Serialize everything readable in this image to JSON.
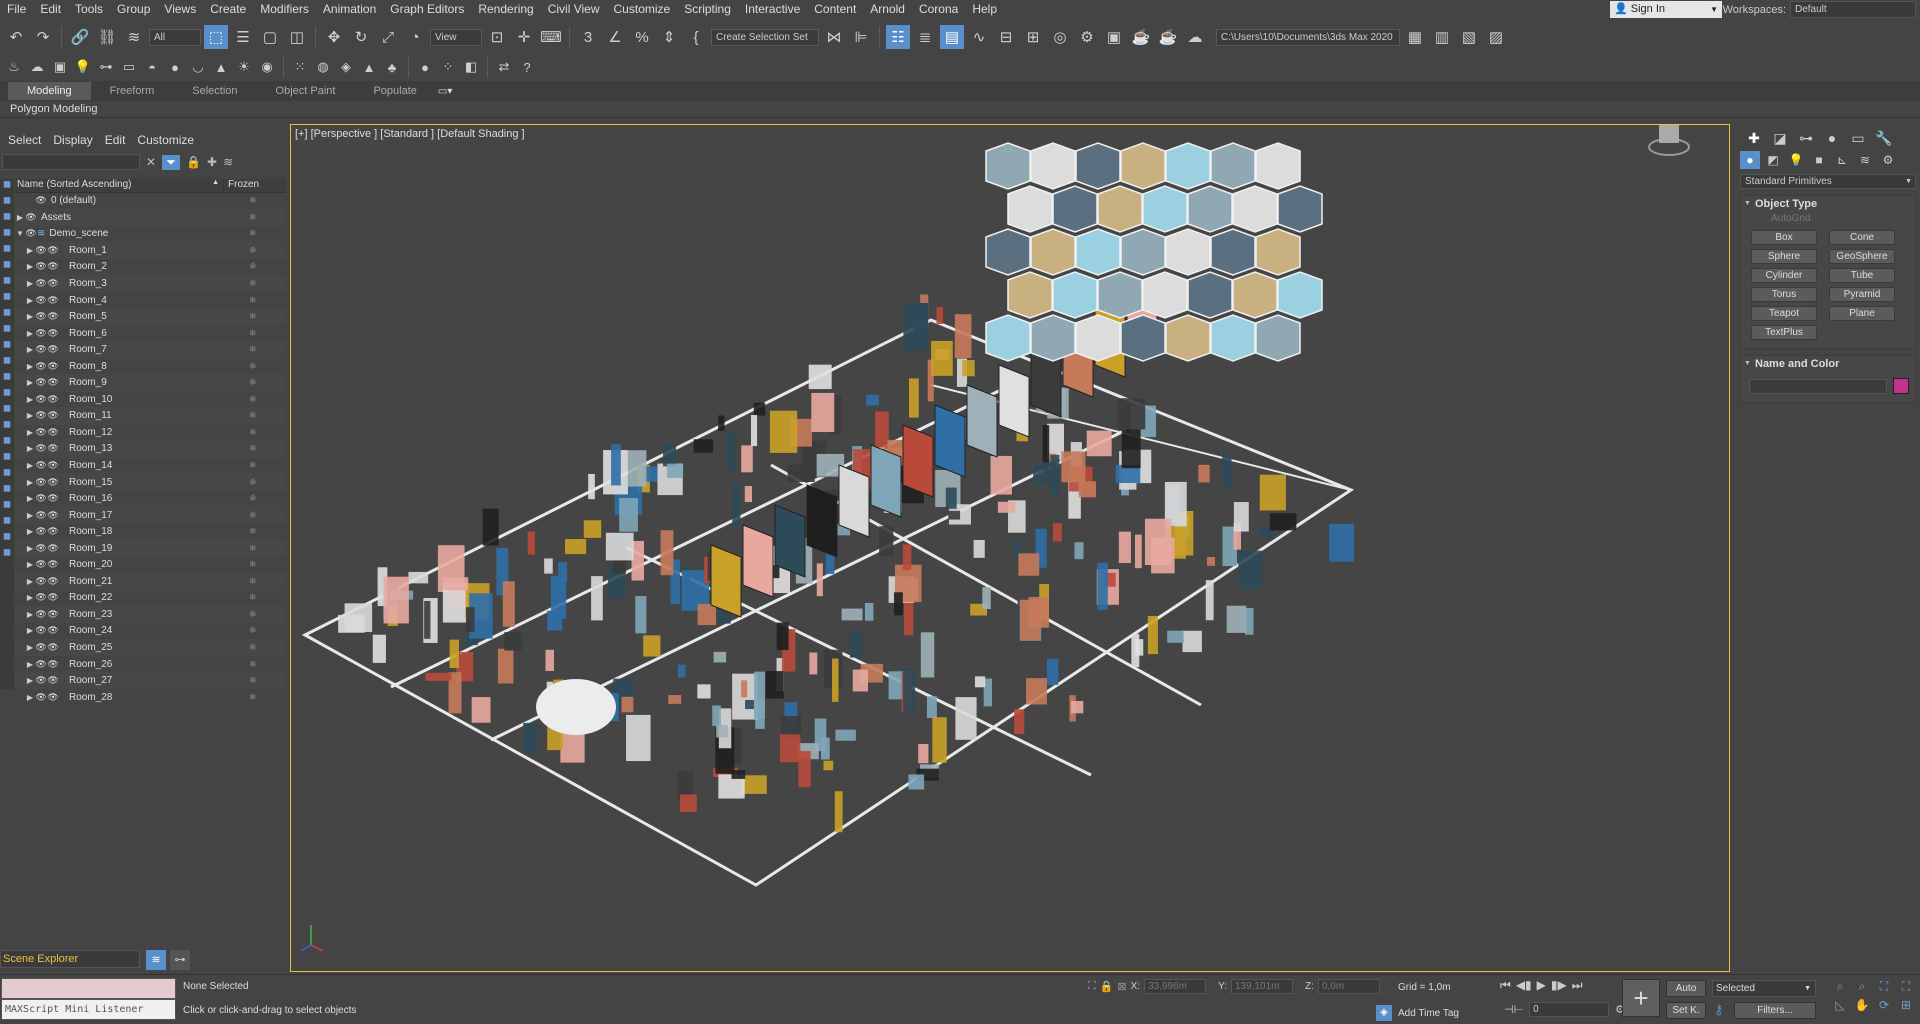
{
  "menu": [
    "File",
    "Edit",
    "Tools",
    "Group",
    "Views",
    "Create",
    "Modifiers",
    "Animation",
    "Graph Editors",
    "Rendering",
    "Civil View",
    "Customize",
    "Scripting",
    "Interactive",
    "Content",
    "Arnold",
    "Corona",
    "Help"
  ],
  "sign_in": "Sign In",
  "workspaces": {
    "label": "Workspaces:",
    "value": "Default"
  },
  "toolbar": {
    "selection_filter": "All",
    "ref_coord": "View",
    "named_selection": "Create Selection Set",
    "project_path": "C:\\Users\\10\\Documents\\3ds Max 2020"
  },
  "ribbon": {
    "tabs": [
      "Modeling",
      "Freeform",
      "Selection",
      "Object Paint",
      "Populate"
    ],
    "sub": "Polygon Modeling"
  },
  "explorer": {
    "menu": [
      "Select",
      "Display",
      "Edit",
      "Customize"
    ],
    "col_name": "Name (Sorted Ascending)",
    "col_frozen": "Frozen",
    "rows": [
      {
        "name": "0 (default)",
        "level": 1,
        "exp": ""
      },
      {
        "name": "Assets",
        "level": 0,
        "exp": "▶"
      },
      {
        "name": "Demo_scene",
        "level": 0,
        "exp": "▼"
      },
      {
        "name": "Room_1",
        "level": 2,
        "exp": "▶"
      },
      {
        "name": "Room_2",
        "level": 2,
        "exp": "▶"
      },
      {
        "name": "Room_3",
        "level": 2,
        "exp": "▶"
      },
      {
        "name": "Room_4",
        "level": 2,
        "exp": "▶"
      },
      {
        "name": "Room_5",
        "level": 2,
        "exp": "▶"
      },
      {
        "name": "Room_6",
        "level": 2,
        "exp": "▶"
      },
      {
        "name": "Room_7",
        "level": 2,
        "exp": "▶"
      },
      {
        "name": "Room_8",
        "level": 2,
        "exp": "▶"
      },
      {
        "name": "Room_9",
        "level": 2,
        "exp": "▶"
      },
      {
        "name": "Room_10",
        "level": 2,
        "exp": "▶"
      },
      {
        "name": "Room_11",
        "level": 2,
        "exp": "▶"
      },
      {
        "name": "Room_12",
        "level": 2,
        "exp": "▶"
      },
      {
        "name": "Room_13",
        "level": 2,
        "exp": "▶"
      },
      {
        "name": "Room_14",
        "level": 2,
        "exp": "▶"
      },
      {
        "name": "Room_15",
        "level": 2,
        "exp": "▶"
      },
      {
        "name": "Room_16",
        "level": 2,
        "exp": "▶"
      },
      {
        "name": "Room_17",
        "level": 2,
        "exp": "▶"
      },
      {
        "name": "Room_18",
        "level": 2,
        "exp": "▶"
      },
      {
        "name": "Room_19",
        "level": 2,
        "exp": "▶"
      },
      {
        "name": "Room_20",
        "level": 2,
        "exp": "▶"
      },
      {
        "name": "Room_21",
        "level": 2,
        "exp": "▶"
      },
      {
        "name": "Room_22",
        "level": 2,
        "exp": "▶"
      },
      {
        "name": "Room_23",
        "level": 2,
        "exp": "▶"
      },
      {
        "name": "Room_24",
        "level": 2,
        "exp": "▶"
      },
      {
        "name": "Room_25",
        "level": 2,
        "exp": "▶"
      },
      {
        "name": "Room_26",
        "level": 2,
        "exp": "▶"
      },
      {
        "name": "Room_27",
        "level": 2,
        "exp": "▶"
      },
      {
        "name": "Room_28",
        "level": 2,
        "exp": "▶"
      }
    ]
  },
  "viewport": {
    "label": "[+] [Perspective ] [Standard ] [Default Shading ]"
  },
  "command_panel": {
    "category": "Standard Primitives",
    "object_type_title": "Object Type",
    "autogrid": "AutoGrid",
    "primitives": [
      "Box",
      "Cone",
      "Sphere",
      "GeoSphere",
      "Cylinder",
      "Tube",
      "Torus",
      "Pyramid",
      "Teapot",
      "Plane",
      "TextPlus"
    ],
    "name_color_title": "Name and Color",
    "object_color": "#c2348c"
  },
  "bottom": {
    "scene_explorer_tab": "Scene Explorer",
    "listener": "MAXScript Mini Listener",
    "selection_status": "None Selected",
    "prompt": "Click or click-and-drag to select objects",
    "x_label": "X:",
    "x_value": "33,996m",
    "y_label": "Y:",
    "y_value": "139,101m",
    "z_label": "Z:",
    "z_value": "0,0m",
    "grid": "Grid = 1,0m",
    "add_time_tag": "Add Time Tag",
    "frame": "0",
    "auto": "Auto",
    "set_key": "Set K.",
    "key_filter_sel": "Selected",
    "filters": "Filters..."
  }
}
